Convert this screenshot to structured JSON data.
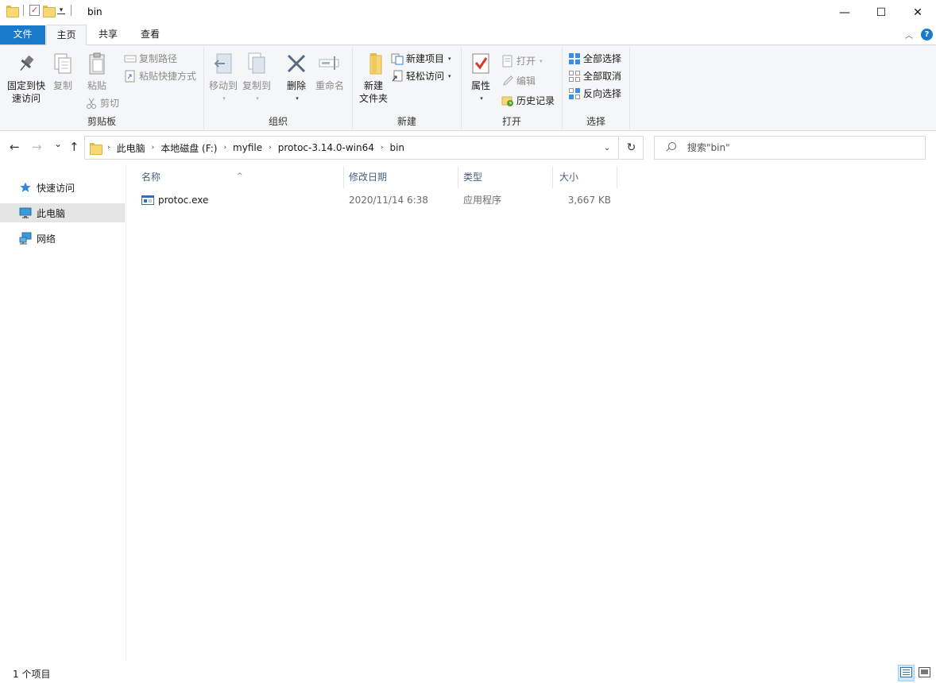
{
  "window": {
    "title": "bin",
    "minimize_glyph": "—",
    "maximize_glyph": "☐",
    "close_glyph": "✕",
    "qat_check_glyph": "✓",
    "qat_dropdown_glyph": "▾"
  },
  "ribbon_tabs": {
    "file": "文件",
    "home": "主页",
    "share": "共享",
    "view": "查看",
    "collapse_glyph": "︿",
    "help_glyph": "?"
  },
  "ribbon": {
    "clipboard": {
      "label": "剪贴板",
      "pin_line1": "固定到快",
      "pin_line2": "速访问",
      "copy": "复制",
      "paste": "粘贴",
      "copy_path": "复制路径",
      "paste_shortcut": "粘贴快捷方式",
      "cut": "剪切"
    },
    "organize": {
      "label": "组织",
      "move_to": "移动到",
      "copy_to": "复制到",
      "delete": "删除",
      "rename": "重命名"
    },
    "new": {
      "label": "新建",
      "new_folder_line1": "新建",
      "new_folder_line2": "文件夹",
      "new_item": "新建项目",
      "easy_access": "轻松访问"
    },
    "open": {
      "label": "打开",
      "properties": "属性",
      "open": "打开",
      "edit": "编辑",
      "history": "历史记录"
    },
    "select": {
      "label": "选择",
      "select_all": "全部选择",
      "select_none": "全部取消",
      "invert": "反向选择"
    }
  },
  "address_bar": {
    "back_glyph": "←",
    "forward_glyph": "→",
    "recent_glyph": "⌄",
    "up_glyph": "↑",
    "crumbs": [
      "此电脑",
      "本地磁盘 (F:)",
      "myfile",
      "protoc-3.14.0-win64",
      "bin"
    ],
    "crumb_sep_glyph": "›",
    "dropdown_glyph": "⌄",
    "refresh_glyph": "↻",
    "search_placeholder": "搜索\"bin\""
  },
  "nav_pane": {
    "quick_access": "快速访问",
    "this_pc": "此电脑",
    "network": "网络"
  },
  "file_list": {
    "sort_glyph": "^",
    "columns": {
      "name": "名称",
      "modified": "修改日期",
      "type": "类型",
      "size": "大小"
    },
    "rows": [
      {
        "name": "protoc.exe",
        "modified": "2020/11/14 6:38",
        "type": "应用程序",
        "size": "3,667 KB"
      }
    ]
  },
  "status_bar": {
    "item_count": "1 个项目"
  },
  "colors": {
    "accent": "#1979ca",
    "selection": "#e5e5e5",
    "folder": "#f8d775",
    "column_header_text": "#4c607a"
  }
}
